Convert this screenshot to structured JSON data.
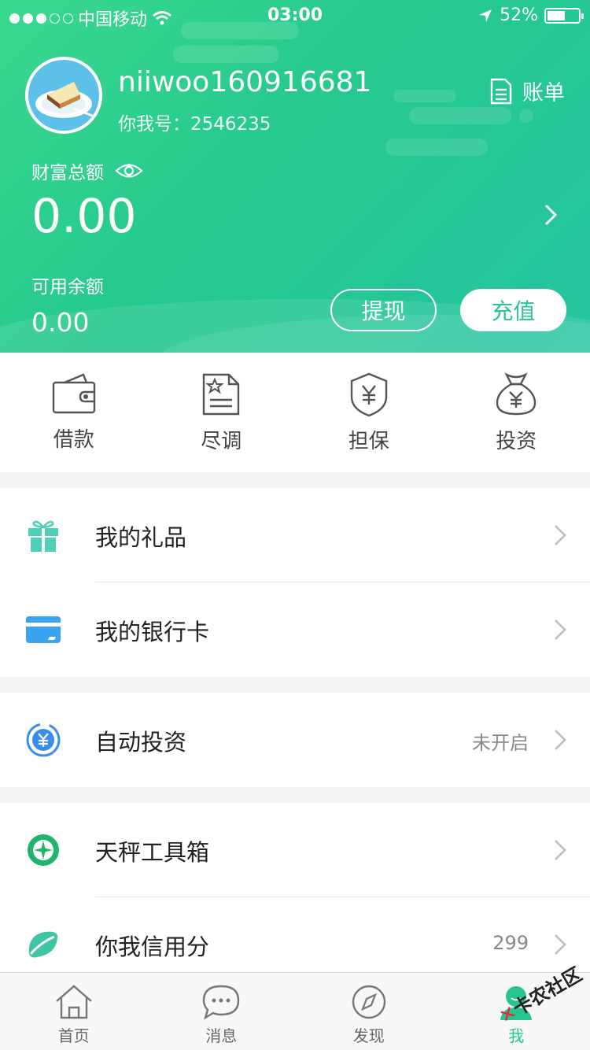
{
  "status_bar": {
    "carrier": "中国移动",
    "time": "03:00",
    "battery_percent": "52%",
    "battery_level": 0.52,
    "signal_bars_filled": 3,
    "signal_bars_total": 5
  },
  "header": {
    "username": "niiwoo160916681",
    "account_no": "你我号：2546235",
    "bill_label": "账单",
    "wealth_label": "财富总额",
    "wealth_value": "0.00",
    "available_label": "可用余额",
    "available_value": "0.00",
    "withdraw_label": "提现",
    "recharge_label": "充值"
  },
  "quick_actions": [
    {
      "label": "借款",
      "icon": "wallet-icon"
    },
    {
      "label": "尽调",
      "icon": "document-star-icon"
    },
    {
      "label": "担保",
      "icon": "shield-yen-icon"
    },
    {
      "label": "投资",
      "icon": "money-bag-icon"
    }
  ],
  "menu": {
    "gifts": {
      "label": "我的礼品",
      "icon": "gift-icon"
    },
    "bank_cards": {
      "label": "我的银行卡",
      "icon": "bank-card-icon"
    },
    "auto_invest": {
      "label": "自动投资",
      "value": "未开启",
      "icon": "auto-invest-icon"
    },
    "toolbox": {
      "label": "天秤工具箱",
      "icon": "compass-icon"
    },
    "credit_score": {
      "label": "你我信用分",
      "value": "299",
      "icon": "leaf-icon"
    }
  },
  "tabbar": [
    {
      "label": "首页",
      "icon": "home-icon"
    },
    {
      "label": "消息",
      "icon": "message-icon"
    },
    {
      "label": "发现",
      "icon": "discover-icon"
    },
    {
      "label": "我",
      "icon": "profile-icon",
      "active": true
    }
  ],
  "watermark": "卡农社区",
  "colors": {
    "brand_green": "#25c58e",
    "blue": "#3a8df0"
  }
}
